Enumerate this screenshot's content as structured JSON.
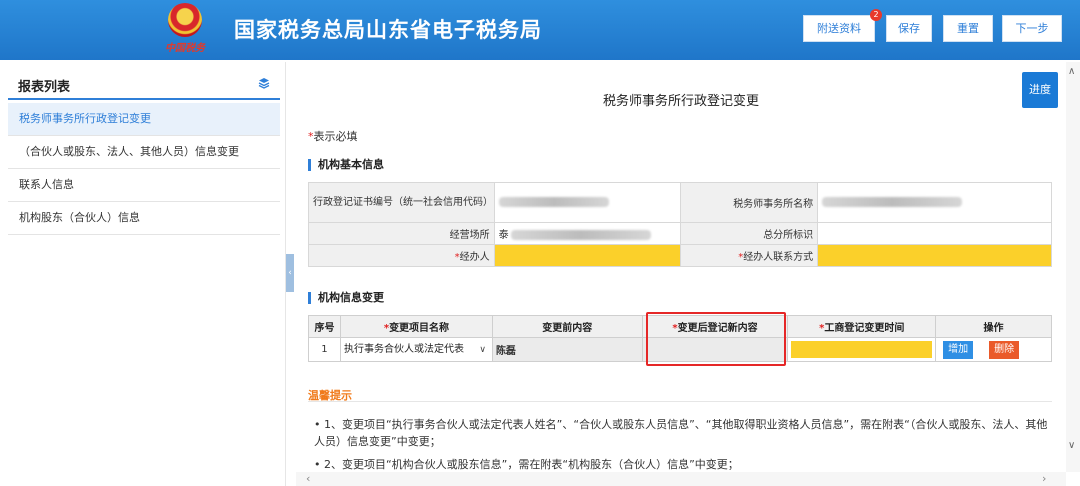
{
  "header": {
    "title": "国家税务总局山东省电子税务局",
    "emblem_signature": "中国税务",
    "buttons": [
      {
        "label": "附送资料",
        "badge": "2"
      },
      {
        "label": "保存"
      },
      {
        "label": "重置"
      },
      {
        "label": "下一步"
      }
    ]
  },
  "sidebar": {
    "heading": "报表列表",
    "items": [
      {
        "label": "税务师事务所行政登记变更",
        "active": true
      },
      {
        "label": "（合伙人或股东、法人、其他人员）信息变更"
      },
      {
        "label": "联系人信息"
      },
      {
        "label": "机构股东（合伙人）信息"
      }
    ]
  },
  "main": {
    "progress_button": "进度",
    "form_title": "税务师事务所行政登记变更",
    "required_note_star": "*",
    "required_note": "表示必填",
    "basic_section": {
      "title": "机构基本信息",
      "rows": [
        {
          "l1": "行政登记证书编号（统一社会信用代码）",
          "l2": "税务师事务所名称"
        },
        {
          "l1": "经营场所",
          "v1": "泰",
          "l2": "总分所标识"
        },
        {
          "l1": "经办人",
          "l2": "经办人联系方式",
          "required": true
        }
      ]
    },
    "change_section": {
      "title": "机构信息变更",
      "columns": [
        "序号",
        "变更项目名称",
        "变更前内容",
        "变更后登记新内容",
        "工商登记变更时间",
        "操作"
      ],
      "required_columns": [
        1,
        3,
        4
      ],
      "row": {
        "index": "1",
        "item": "执行事务合伙人或法定代表",
        "before": "陈磊",
        "add_label": "增加",
        "delete_label": "删除"
      }
    },
    "tips": {
      "title": "温馨提示",
      "items": [
        "• 1、变更项目“执行事务合伙人或法定代表人姓名”、“合伙人或股东人员信息”、“其他取得职业资格人员信息”，需在附表“（合伙人或股东、法人、其他人员）信息变更”中变更；",
        "• 2、变更项目“机构合伙人或股东信息”，需在附表“机构股东（合伙人）信息”中变更；"
      ]
    }
  },
  "colors": {
    "header_blue": "#1f76c9",
    "accent_blue": "#2f7fd8",
    "required_yellow": "#fbd02a",
    "highlight_red": "#e52727",
    "tip_orange": "#f07a1a"
  }
}
